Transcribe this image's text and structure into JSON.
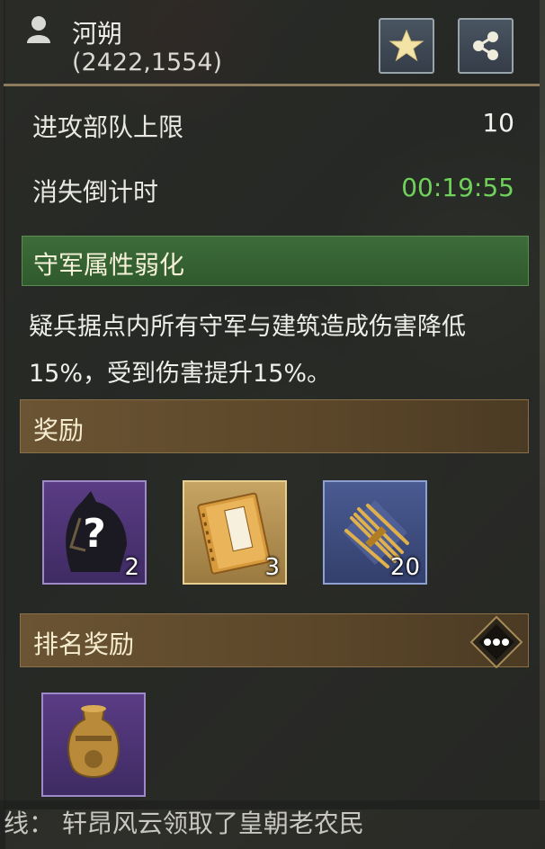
{
  "header": {
    "name": "河朔",
    "coords": "(2422,1554)",
    "icons": {
      "person": "person-icon",
      "star": "star-icon",
      "share": "share-icon"
    }
  },
  "stats": {
    "attack_limit_label": "进攻部队上限",
    "attack_limit_value": "10",
    "countdown_label": "消失倒计时",
    "countdown_value": "00:19:55"
  },
  "effect": {
    "title": "守军属性弱化",
    "description": "疑兵据点内所有守军与建筑造成伤害降低15%，受到伤害提升15%。"
  },
  "rewards": {
    "title": "奖励",
    "items": [
      {
        "icon": "horse-mystery-icon",
        "count": "2",
        "rarity": "purple"
      },
      {
        "icon": "book-icon",
        "count": "3",
        "rarity": "gold"
      },
      {
        "icon": "grain-bundle-icon",
        "count": "20",
        "rarity": "blue"
      }
    ]
  },
  "ranking": {
    "title": "排名奖励",
    "items": [
      {
        "icon": "tribute-vase-icon",
        "rarity": "purple"
      }
    ]
  },
  "ticker": {
    "text": "线：  轩昂风云领取了皇朝老农民"
  },
  "colors": {
    "countdown": "#6fd25a",
    "effect_bar": "#3e6c3a",
    "section_bar": "#5b4629"
  }
}
